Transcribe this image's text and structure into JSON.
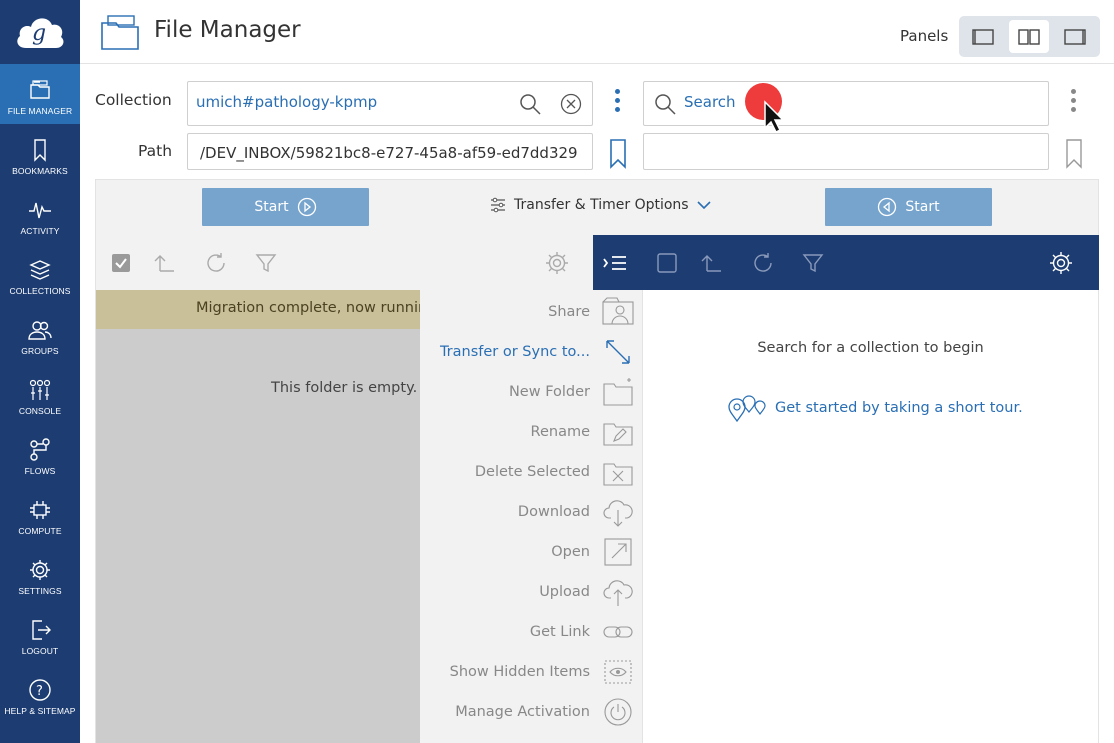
{
  "header": {
    "title": "File Manager",
    "panels_label": "Panels"
  },
  "sidebar": {
    "items": [
      {
        "label": "FILE MANAGER",
        "icon": "file-manager-icon",
        "active": true
      },
      {
        "label": "BOOKMARKS",
        "icon": "bookmark-icon"
      },
      {
        "label": "ACTIVITY",
        "icon": "activity-icon"
      },
      {
        "label": "COLLECTIONS",
        "icon": "collections-icon"
      },
      {
        "label": "GROUPS",
        "icon": "groups-icon"
      },
      {
        "label": "CONSOLE",
        "icon": "console-icon"
      },
      {
        "label": "FLOWS",
        "icon": "flows-icon"
      },
      {
        "label": "COMPUTE",
        "icon": "compute-icon"
      },
      {
        "label": "SETTINGS",
        "icon": "settings-icon"
      },
      {
        "label": "LOGOUT",
        "icon": "logout-icon"
      },
      {
        "label": "HELP & SITEMAP",
        "icon": "help-icon"
      }
    ]
  },
  "left": {
    "collection_label": "Collection",
    "collection_value": "umich#pathology-kpmp",
    "path_label": "Path",
    "path_value": "/DEV_INBOX/59821bc8-e727-45a8-af59-ed7dd329",
    "banner": "Migration complete, now running",
    "empty_message": "This folder is empty."
  },
  "right": {
    "search_placeholder": "Search",
    "path_value": "",
    "hint": "Search for a collection to begin",
    "tour_link": "Get started by taking a short tour."
  },
  "transfer": {
    "start_left": "Start",
    "start_right": "Start",
    "options": "Transfer & Timer Options"
  },
  "menu": {
    "items": [
      {
        "label": "Share",
        "icon": "share-icon"
      },
      {
        "label": "Transfer or Sync to...",
        "icon": "transfer-icon"
      },
      {
        "label": "New Folder",
        "icon": "new-folder-icon"
      },
      {
        "label": "Rename",
        "icon": "rename-icon"
      },
      {
        "label": "Delete Selected",
        "icon": "delete-icon"
      },
      {
        "label": "Download",
        "icon": "download-icon"
      },
      {
        "label": "Open",
        "icon": "open-icon"
      },
      {
        "label": "Upload",
        "icon": "upload-icon"
      },
      {
        "label": "Get Link",
        "icon": "link-icon"
      },
      {
        "label": "Show Hidden Items",
        "icon": "eye-icon"
      },
      {
        "label": "Manage Activation",
        "icon": "power-icon"
      }
    ]
  },
  "colors": {
    "sidebar": "#1d3d72",
    "accent": "#2a6fb4",
    "start_button": "#76a4cd",
    "banner": "#c9bf99",
    "cursor_dot": "#ee3b3b"
  }
}
